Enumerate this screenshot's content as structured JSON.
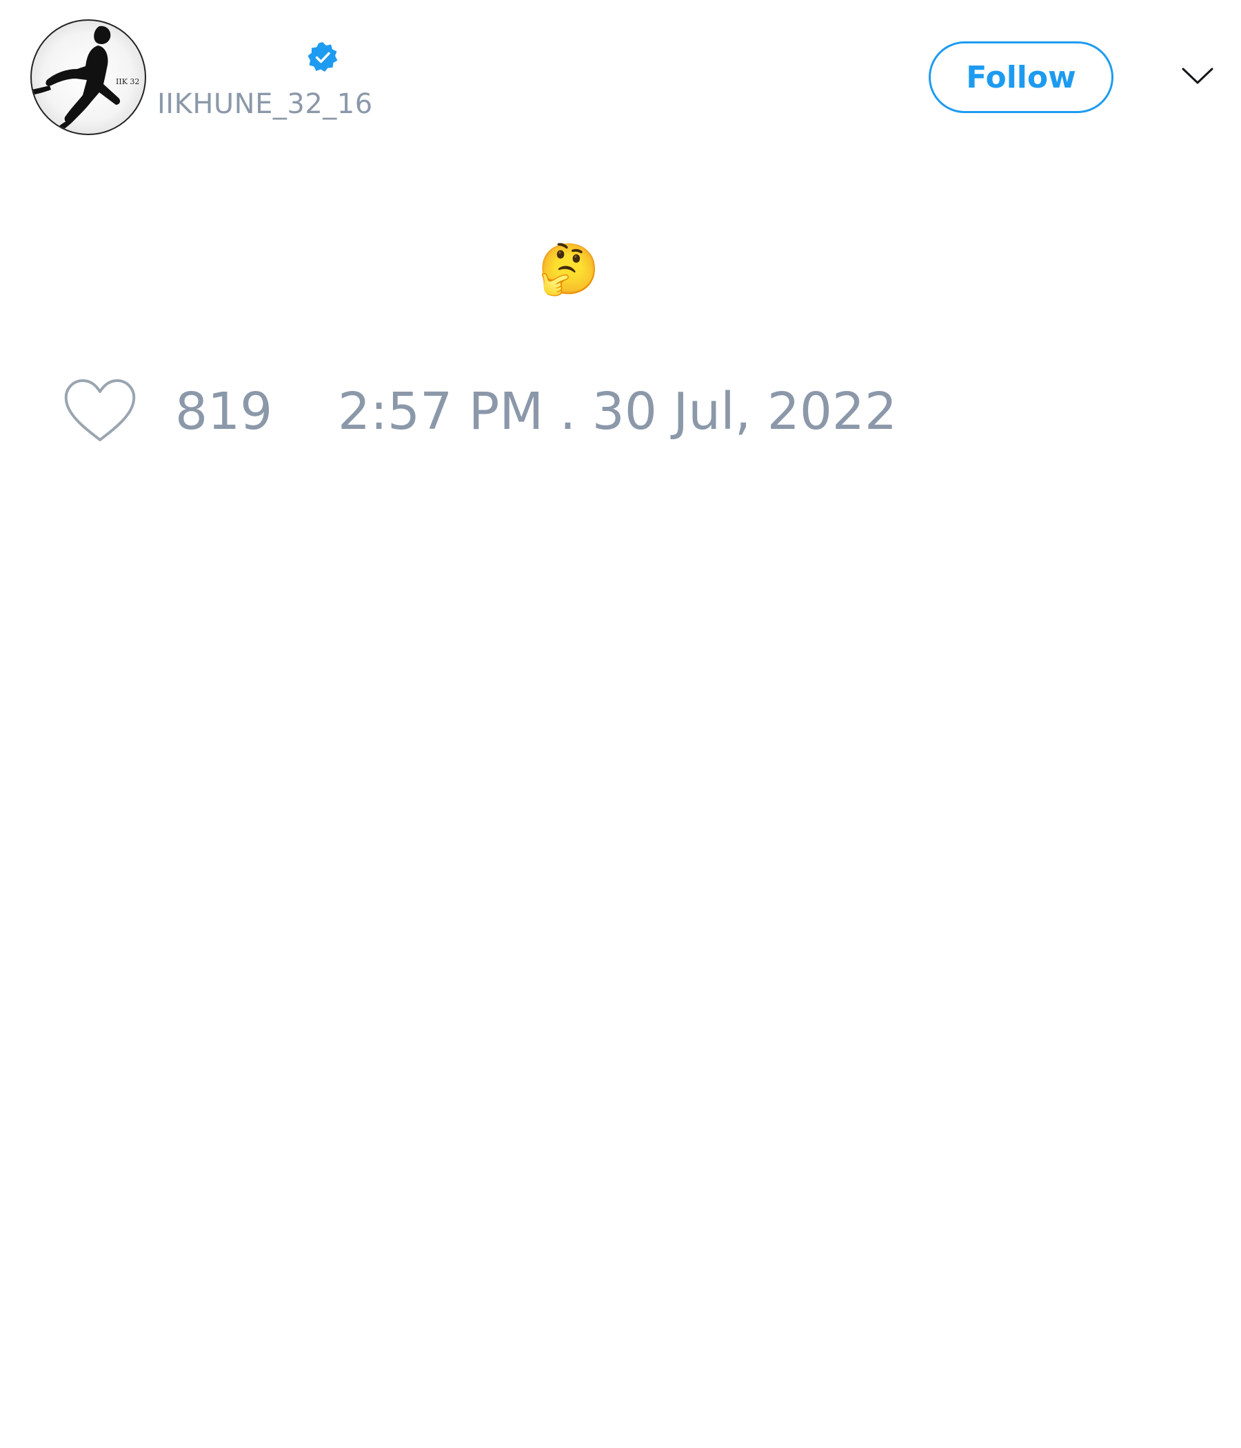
{
  "user": {
    "display_name": "",
    "handle": "IIKHUNE_32_16",
    "verified": true,
    "avatar_badge_text": "IIK 32"
  },
  "header": {
    "follow_label": "Follow"
  },
  "icons": {
    "verified": "verified-badge-icon",
    "menu": "chevron-down-icon",
    "like": "heart-icon"
  },
  "tweet": {
    "text": "🤔"
  },
  "stats": {
    "likes": "819",
    "timestamp": "2:57 PM . 30 Jul, 2022"
  },
  "colors": {
    "accent": "#1d9bf0",
    "muted_text": "#8b98a9",
    "icon_gray": "#9aa5b1"
  }
}
